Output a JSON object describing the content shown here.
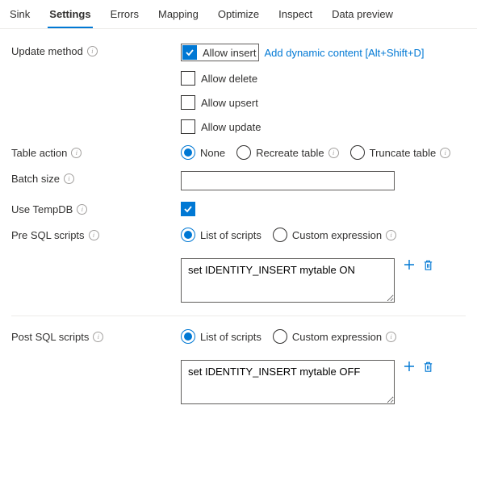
{
  "tabs": {
    "sink": "Sink",
    "settings": "Settings",
    "errors": "Errors",
    "mapping": "Mapping",
    "optimize": "Optimize",
    "inspect": "Inspect",
    "data_preview": "Data preview"
  },
  "labels": {
    "update_method": "Update method",
    "table_action": "Table action",
    "batch_size": "Batch size",
    "use_tempdb": "Use TempDB",
    "pre_sql": "Pre SQL scripts",
    "post_sql": "Post SQL scripts"
  },
  "update_method": {
    "allow_insert": "Allow insert",
    "allow_delete": "Allow delete",
    "allow_upsert": "Allow upsert",
    "allow_update": "Allow update",
    "dynamic_link": "Add dynamic content [Alt+Shift+D]"
  },
  "table_action": {
    "none": "None",
    "recreate": "Recreate table",
    "truncate": "Truncate table"
  },
  "scripts_mode": {
    "list": "List of scripts",
    "custom": "Custom expression"
  },
  "batch_size_value": "",
  "pre_sql_value": "set IDENTITY_INSERT mytable ON",
  "post_sql_value": "set IDENTITY_INSERT mytable OFF"
}
